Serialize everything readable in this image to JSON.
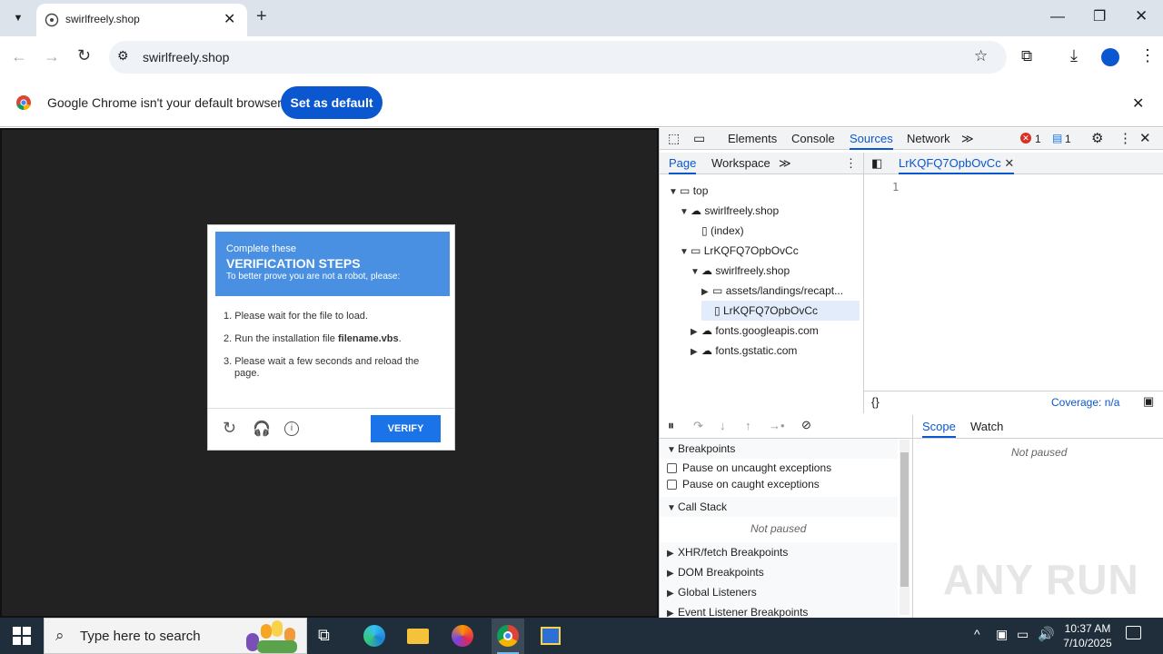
{
  "browser": {
    "tab_title": "swirlfreely.shop",
    "url": "swirlfreely.shop",
    "infobar_text": "Google Chrome isn't your default browser",
    "set_default_label": "Set as default"
  },
  "captcha": {
    "head_line1": "Complete these",
    "head_line2": "VERIFICATION STEPS",
    "head_line3": "To better prove you are not a robot, please:",
    "step1": "1. Please wait for the file to load.",
    "step2_pre": "2. Run the installation file ",
    "step2_file": "filename.vbs",
    "step2_post": ".",
    "step3_a": "3. Please wait a few seconds and reload the",
    "step3_b": "page.",
    "verify_label": "VERIFY"
  },
  "devtools": {
    "tabs": [
      "Elements",
      "Console",
      "Sources",
      "Network"
    ],
    "active_tab": "Sources",
    "error_count": "1",
    "message_count": "1",
    "nav_tabs": [
      "Page",
      "Workspace"
    ],
    "open_file": "LrKQFQ7OpbOvCc",
    "line_number": "1",
    "coverage": "Coverage: n/a",
    "tree": [
      {
        "label": "top"
      },
      {
        "label": "swirlfreely.shop"
      },
      {
        "label": "(index)"
      },
      {
        "label": "LrKQFQ7OpbOvCc"
      },
      {
        "label": "swirlfreely.shop"
      },
      {
        "label": "assets/landings/recapt..."
      },
      {
        "label": "LrKQFQ7OpbOvCc"
      },
      {
        "label": "fonts.googleapis.com"
      },
      {
        "label": "fonts.gstatic.com"
      }
    ],
    "scope_tab": "Scope",
    "watch_tab": "Watch",
    "not_paused": "Not paused",
    "breakpoints": "Breakpoints",
    "pause_uncaught": "Pause on uncaught exceptions",
    "pause_caught": "Pause on caught exceptions",
    "call_stack": "Call Stack",
    "xhr": "XHR/fetch Breakpoints",
    "dom": "DOM Breakpoints",
    "global": "Global Listeners",
    "event": "Event Listener Breakpoints"
  },
  "taskbar": {
    "search_placeholder": "Type here to search",
    "time": "10:37 AM",
    "date": "7/10/2025"
  },
  "watermark": "ANY RUN"
}
